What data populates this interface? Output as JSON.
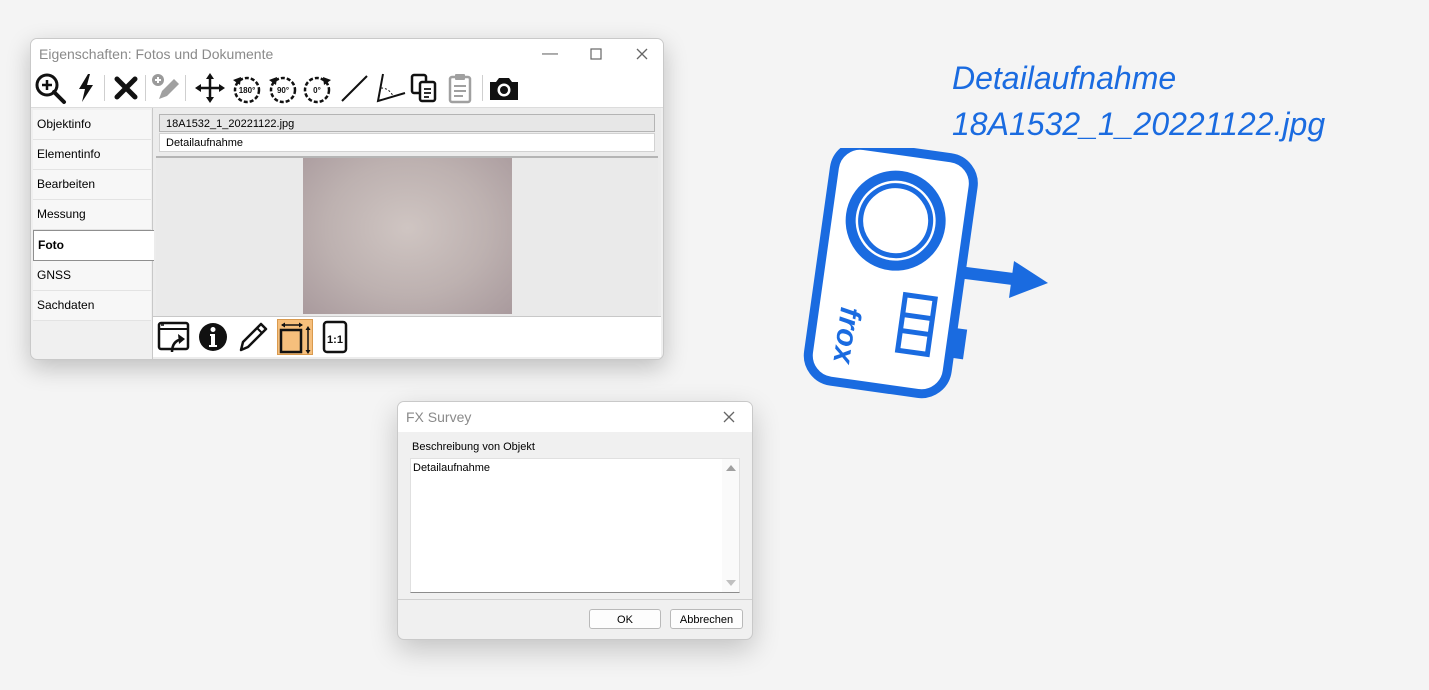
{
  "properties_window": {
    "title": "Eigenschaften: Fotos und Dokumente",
    "toolbar": {
      "icons": [
        "zoom-in-icon",
        "lightning-icon",
        "delete-icon",
        "edit-add-icon",
        "move-icon",
        "rotate-180-icon",
        "rotate-90-icon",
        "rotate-0-icon",
        "line-icon",
        "angle-icon",
        "copy-icon",
        "paste-icon",
        "camera-icon"
      ],
      "rotate_labels": [
        "180°",
        "90°",
        "0°"
      ]
    },
    "nav": {
      "items": [
        "Objektinfo",
        "Elementinfo",
        "Bearbeiten",
        "Messung",
        "Foto",
        "GNSS",
        "Sachdaten"
      ],
      "active": "Foto"
    },
    "photo": {
      "filename": "18A1532_1_20221122.jpg",
      "description": "Detailaufnahme"
    },
    "bottom_toolbar": {
      "icons": [
        "open-external-icon",
        "info-icon",
        "pencil-icon",
        "fit-size-icon",
        "actual-size-icon"
      ],
      "actual_size_label": "1:1",
      "active": "fit-size-icon"
    }
  },
  "dialog": {
    "title": "FX Survey",
    "label": "Beschreibung von Objekt",
    "text": "Detailaufnahme",
    "ok_label": "OK",
    "cancel_label": "Abbrechen"
  },
  "hero": {
    "line1": "Detailaufnahme",
    "line2": "18A1532_1_20221122.jpg",
    "logo_text": "frox",
    "color": "#1a6be0"
  }
}
